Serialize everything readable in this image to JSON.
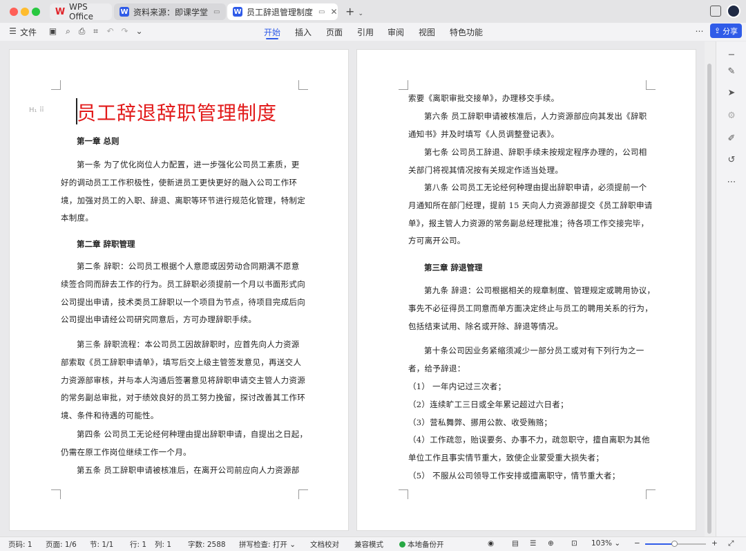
{
  "app": {
    "tabs": [
      {
        "label": "WPS Office"
      },
      {
        "label": "资料来源：即课学堂"
      },
      {
        "label": "员工辞退管理制度"
      }
    ]
  },
  "toolbar": {
    "file_label": "文件",
    "ribbon_tabs": [
      "开始",
      "插入",
      "页面",
      "引用",
      "审阅",
      "视图",
      "特色功能"
    ],
    "share_label": "分享"
  },
  "document": {
    "title": "员工辞退辞职管理制度",
    "left_page": {
      "ch1": "第一章  总则",
      "a1": [
        "第一条  为了优化岗位人力配置，进一步强化公司员工素质，更",
        "好的调动员工工作积极性，使新进员工更快更好的融入公司工作环",
        "境，加强对员工的入职、辞退、离职等环节进行规范化管理，特制定",
        "本制度。"
      ],
      "ch2": "第二章  辞职管理",
      "a2": [
        "第二条  辞职：公司员工根据个人意愿或因劳动合同期满不愿意",
        "续签合同而辞去工作的行为。员工辞职必须提前一个月以书面形式向",
        "公司提出申请，技术类员工辞职以一个项目为节点，待项目完成后向",
        "公司提出申请经公司研究同意后，方可办理辞职手续。"
      ],
      "a3": [
        "第三条  辞职流程：本公司员工因故辞职时，应首先向人力资源",
        "部索取《员工辞职申请单》，填写后交上级主管签发意见，再送交人",
        "力资源部审核，并与本人沟通后签署意见将辞职申请交主管人力资源",
        "的常务副总审批，对于绩效良好的员工努力挽留，探讨改善其工作环",
        "境、条件和待遇的可能性。"
      ],
      "a4": [
        "第四条  公司员工无论经何种理由提出辞职申请，自提出之日起，",
        "仍需在原工作岗位继续工作一个月。"
      ],
      "a5": [
        "第五条  员工辞职申请被核准后，在离开公司前应向人力资源部"
      ]
    },
    "right_page": {
      "cont": "索要《离职审批交接单》，办理移交手续。",
      "a6": [
        "第六条  员工辞职申请被核准后，人力资源部应向其发出《辞职",
        "通知书》并及时填写《人员调整登记表》。"
      ],
      "a7": [
        "第七条  公司员工辞退、辞职手续未按规定程序办理的，公司相",
        "关部门将视其情况按有关规定作适当处理。"
      ],
      "a8": [
        "第八条  公司员工无论经何种理由提出辞职申请，必须提前一个",
        "月通知所在部门经理，提前 15 天向人力资源部提交《员工辞职申请",
        "单》，报主管人力资源的常务副总经理批准；待各项工作交接完毕，",
        "方可离开公司。"
      ],
      "ch3": "第三章  辞退管理",
      "a9": [
        "第九条  辞退：公司根据相关的规章制度、管理规定或聘用协议，",
        "事先不必征得员工同意而单方面决定终止与员工的聘用关系的行为，",
        "包括结束试用、除名或开除、辞退等情况。"
      ],
      "a10": [
        "第十条公司因业务紧缩须减少一部分员工或对有下列行为之一",
        "者，给予辞退："
      ],
      "items": [
        "（1）  一年内记过三次者；",
        "（2）连续旷工三日或全年累记超过六日者；",
        "（3）营私舞弊、挪用公款、收受贿赂；",
        "（4）工作疏忽，贻误要务、办事不力，疏忽职守，擅自离职为其他",
        "单位工作且事实情节重大，致使企业蒙受重大损失者；",
        "（5）  不服从公司领导工作安排或擅离职守，情节重大者；"
      ]
    }
  },
  "statusbar": {
    "page_no": "页码: 1",
    "page": "页面: 1/6",
    "section": "节: 1/1",
    "row": "行: 1",
    "col": "列: 1",
    "words": "字数: 2588",
    "spell": "拼写检查: 打开",
    "proof": "文档校对",
    "compat": "兼容模式",
    "backup": "本地备份开",
    "zoom": "103%",
    "zoom_fraction": 0.48
  }
}
